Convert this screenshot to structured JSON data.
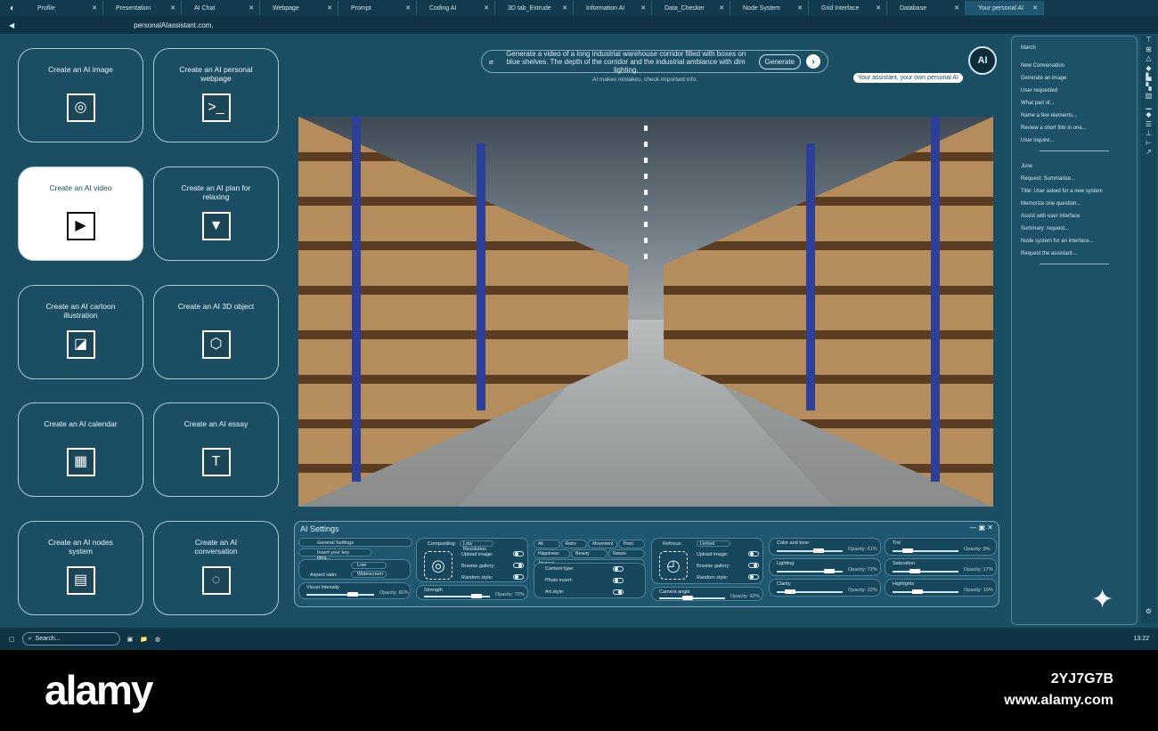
{
  "tabs": [
    "Profile",
    "Presentation",
    "AI Chat",
    "Webpage",
    "Prompt",
    "Coding AI",
    "3D tab_Extrude",
    "Information AI",
    "Data_Checker",
    "Node System",
    "Grid Interface",
    "Database",
    "Your personal AI"
  ],
  "address": "personalAIassistant.com.",
  "cards": [
    {
      "label": "Create an AI image",
      "icon": "image-icon",
      "glyph": "◎"
    },
    {
      "label": "Create an AI personal webpage",
      "icon": "terminal-icon",
      "glyph": ">_"
    },
    {
      "label": "Create an AI video",
      "icon": "play-icon",
      "glyph": "▶"
    },
    {
      "label": "Create an AI plan for relaxing",
      "icon": "plan-icon",
      "glyph": "▼"
    },
    {
      "label": "Create an AI cartoon illustration",
      "icon": "illustration-icon",
      "glyph": "◪"
    },
    {
      "label": "Create an AI 3D object",
      "icon": "cube-icon",
      "glyph": "⬡"
    },
    {
      "label": "Create an AI calendar",
      "icon": "calendar-icon",
      "glyph": "▦"
    },
    {
      "label": "Create an AI essay",
      "icon": "text-icon",
      "glyph": "T"
    },
    {
      "label": "Create an AI nodes system",
      "icon": "nodes-icon",
      "glyph": "▤"
    },
    {
      "label": "Create an AI conversation",
      "icon": "conversation-icon",
      "glyph": "◌"
    }
  ],
  "prompt": {
    "text": "Generate a video of a long industrial warehouse corridor filled with boxes on blue shelves. The depth of the corridor and the industrial ambiance with dim lighting.",
    "generate": "Generate",
    "note": "AI makes mistakes, check important info.",
    "assistant": "Your assistant, your own personal AI",
    "avatar": "AI"
  },
  "settings": {
    "title": "AI Settings",
    "general": "General Settings",
    "insert": "Insert your key idea...",
    "quality_value": "Low",
    "aspect_label": "Aspect ratio:",
    "aspect_value": "Widescreen",
    "visual_intensity": "Visual Intensity",
    "vi_opacity": "Opacity: 81%",
    "vi_value": 0.6,
    "compositing": "Compositing:",
    "compositing_value": "Low Resolution",
    "upload": "Upload image:",
    "browse": "Browse gallery:",
    "random": "Random style:",
    "strength": "Strength",
    "strength_opacity": "Opacity: 72%",
    "strength_value": 0.72,
    "chips": [
      "All",
      "Retro",
      "Movement",
      "Point",
      "Happiness",
      "Beauty",
      "Nature",
      "Abstract"
    ],
    "content_type": "Content type:",
    "photo_insert": "Photo insert:",
    "art_style": "Art style:",
    "refocus": "Refocus:",
    "refocus_value": "Linked",
    "upload2": "Upload image:",
    "browse2": "Browse gallery:",
    "random2": "Random style:",
    "camera": "Camera angle",
    "camera_opacity": "Opacity: 42%",
    "camera_value": 0.35,
    "sliders": [
      {
        "label": "Color and tone",
        "opacity": "Opacity: 61%",
        "value": 0.55
      },
      {
        "label": "Tint",
        "opacity": "Opacity: 8%",
        "value": 0.15
      },
      {
        "label": "Lighting",
        "opacity": "Opacity: 72%",
        "value": 0.72
      },
      {
        "label": "Saturation",
        "opacity": "Opacity: 17%",
        "value": 0.25
      },
      {
        "label": "Clarity",
        "opacity": "Opacity: 22%",
        "value": 0.12
      },
      {
        "label": "Highlights",
        "opacity": "Opacity: 19%",
        "value": 0.3
      }
    ]
  },
  "history": {
    "march": "March",
    "march_items": [
      "New Conversation",
      "Generate an image",
      "User requested",
      "What part of...",
      "Name a few elements...",
      "Review a short film in one...",
      "User inquire..."
    ],
    "june": "June",
    "june_items": [
      "Request: Summarize...",
      "Title: User asked for a new system",
      "Memorize one question...",
      "Assist with user interface",
      "Summary: request...",
      "Node system for an interface...",
      "Request the assistant..."
    ]
  },
  "taskbar": {
    "search": "Search...",
    "time": "13:22"
  },
  "watermark": {
    "brand": "alamy",
    "id": "2YJ7G7B",
    "url": "www.alamy.com"
  }
}
